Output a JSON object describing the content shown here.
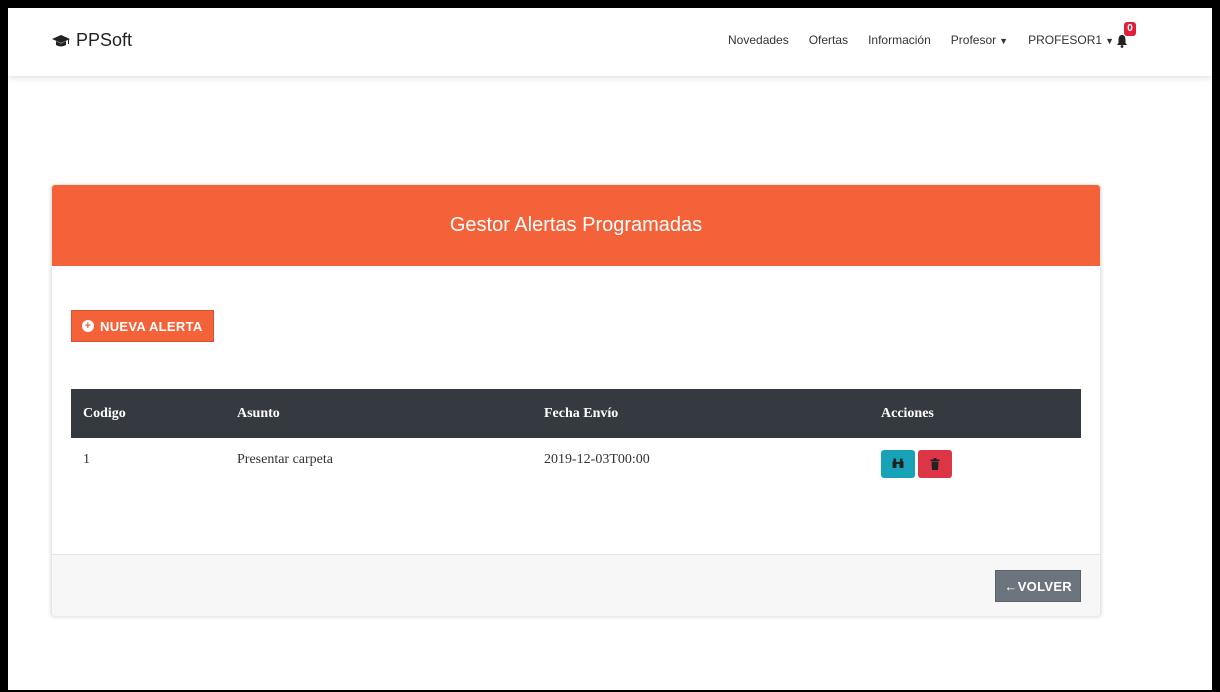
{
  "app": {
    "brand": "PPSoft",
    "brand_icon": "graduation-cap-icon"
  },
  "nav": {
    "items": [
      {
        "label": "Novedades"
      },
      {
        "label": "Ofertas"
      },
      {
        "label": "Información"
      },
      {
        "label": "Profesor",
        "dropdown": true
      },
      {
        "label": "PROFESOR1",
        "dropdown": true
      }
    ],
    "notifications": {
      "icon": "bell-icon",
      "count": "0",
      "badge_color": "#e0203a"
    }
  },
  "card": {
    "title": "Gestor Alertas Programadas",
    "header_color": "#f4623a",
    "new_button": "NUEVA ALERTA",
    "back_button": "←VOLVER"
  },
  "table": {
    "columns": [
      "Codigo",
      "Asunto",
      "Fecha Envío",
      "Acciones"
    ],
    "rows": [
      {
        "codigo": "1",
        "asunto": "Presentar carpeta",
        "fecha": "2019-12-03T00:00"
      }
    ],
    "actions": [
      {
        "icon": "binoculars-icon",
        "color": "#17a2b8"
      },
      {
        "icon": "trash-icon",
        "color": "#dc3545"
      }
    ]
  }
}
